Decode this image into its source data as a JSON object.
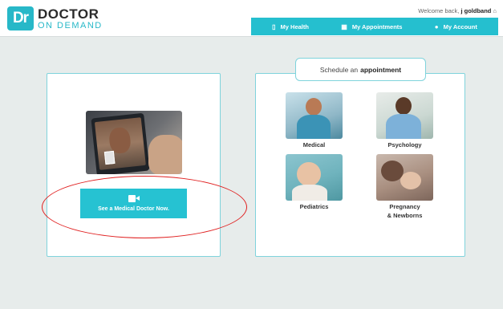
{
  "logo": {
    "badge": "Dr",
    "top": "DOCTOR",
    "bottom": "ON DEMAND"
  },
  "header": {
    "welcome_prefix": "Welcome back, ",
    "username": "j goldband",
    "home_icon": "home-icon"
  },
  "nav": {
    "items": [
      {
        "label": "My Health",
        "icon": "document-icon"
      },
      {
        "label": "My Appointments",
        "icon": "calendar-icon"
      },
      {
        "label": "My Account",
        "icon": "person-icon"
      }
    ]
  },
  "left": {
    "cta_prefix": "See a ",
    "cta_bold": "Medical Doctor",
    "cta_suffix": " Now.",
    "cta_icon": "video-camera-icon"
  },
  "right": {
    "schedule_prefix": "Schedule an",
    "schedule_bold": "appointment",
    "categories": [
      {
        "label": "Medical"
      },
      {
        "label": "Psychology"
      },
      {
        "label": "Pediatrics"
      },
      {
        "label": "Pregnancy",
        "label2": "& Newborns"
      }
    ]
  },
  "colors": {
    "accent": "#25bfcf",
    "annotation": "#e02020"
  }
}
